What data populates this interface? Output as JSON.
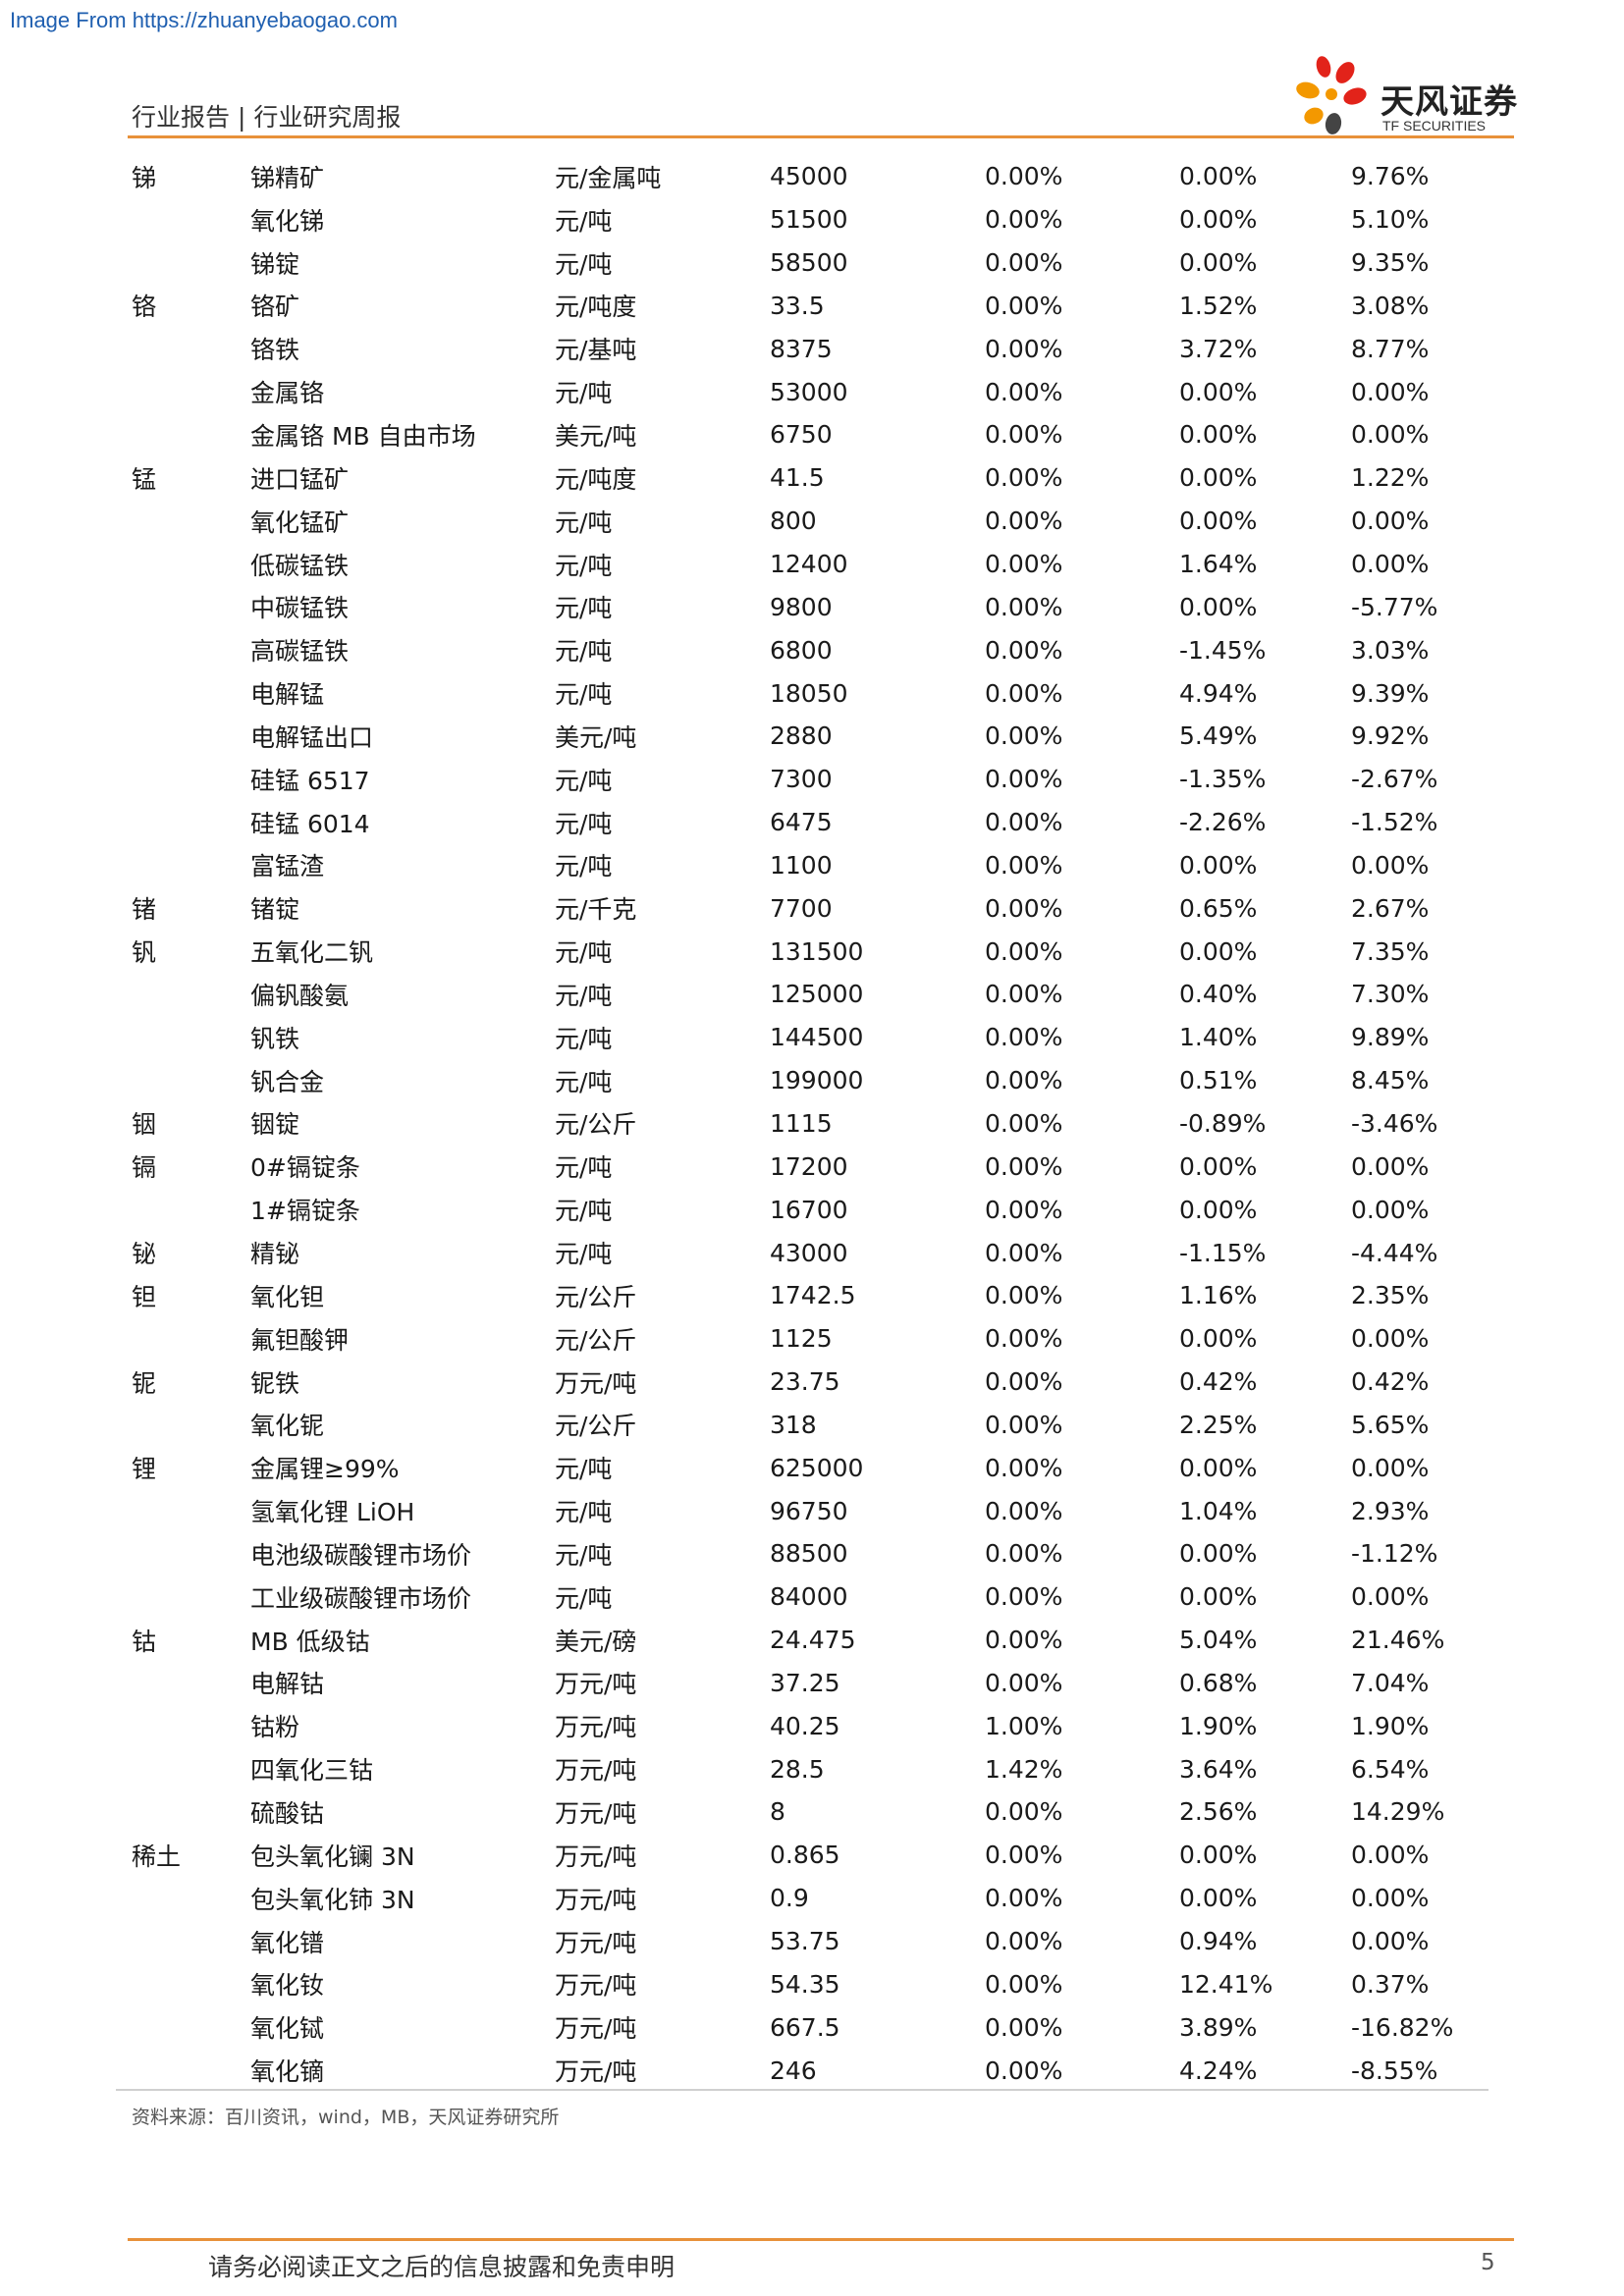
{
  "source_url": "Image From https://zhuanyebaogao.com",
  "header": {
    "title": "行业报告 | 行业研究周报",
    "logo_name": "天风证券",
    "logo_sub": "TF SECURITIES"
  },
  "table": {
    "rows": [
      {
        "metal": "锑",
        "product": "锑精矿",
        "unit": "元/金属吨",
        "price": "45000",
        "weekly": "0.00%",
        "monthly": "0.00%",
        "yearly": "9.76%"
      },
      {
        "metal": "",
        "product": "氧化锑",
        "unit": "元/吨",
        "price": "51500",
        "weekly": "0.00%",
        "monthly": "0.00%",
        "yearly": "5.10%"
      },
      {
        "metal": "",
        "product": "锑锭",
        "unit": "元/吨",
        "price": "58500",
        "weekly": "0.00%",
        "monthly": "0.00%",
        "yearly": "9.35%"
      },
      {
        "metal": "铬",
        "product": "铬矿",
        "unit": "元/吨度",
        "price": "33.5",
        "weekly": "0.00%",
        "monthly": "1.52%",
        "yearly": "3.08%"
      },
      {
        "metal": "",
        "product": "铬铁",
        "unit": "元/基吨",
        "price": "8375",
        "weekly": "0.00%",
        "monthly": "3.72%",
        "yearly": "8.77%"
      },
      {
        "metal": "",
        "product": "金属铬",
        "unit": "元/吨",
        "price": "53000",
        "weekly": "0.00%",
        "monthly": "0.00%",
        "yearly": "0.00%"
      },
      {
        "metal": "",
        "product": "金属铬 MB 自由市场",
        "unit": "美元/吨",
        "price": "6750",
        "weekly": "0.00%",
        "monthly": "0.00%",
        "yearly": "0.00%"
      },
      {
        "metal": "锰",
        "product": "进口锰矿",
        "unit": "元/吨度",
        "price": "41.5",
        "weekly": "0.00%",
        "monthly": "0.00%",
        "yearly": "1.22%"
      },
      {
        "metal": "",
        "product": "氧化锰矿",
        "unit": "元/吨",
        "price": "800",
        "weekly": "0.00%",
        "monthly": "0.00%",
        "yearly": "0.00%"
      },
      {
        "metal": "",
        "product": "低碳锰铁",
        "unit": "元/吨",
        "price": "12400",
        "weekly": "0.00%",
        "monthly": "1.64%",
        "yearly": "0.00%"
      },
      {
        "metal": "",
        "product": "中碳锰铁",
        "unit": "元/吨",
        "price": "9800",
        "weekly": "0.00%",
        "monthly": "0.00%",
        "yearly": "-5.77%"
      },
      {
        "metal": "",
        "product": "高碳锰铁",
        "unit": "元/吨",
        "price": "6800",
        "weekly": "0.00%",
        "monthly": "-1.45%",
        "yearly": "3.03%"
      },
      {
        "metal": "",
        "product": "电解锰",
        "unit": "元/吨",
        "price": "18050",
        "weekly": "0.00%",
        "monthly": "4.94%",
        "yearly": "9.39%"
      },
      {
        "metal": "",
        "product": "电解锰出口",
        "unit": "美元/吨",
        "price": "2880",
        "weekly": "0.00%",
        "monthly": "5.49%",
        "yearly": "9.92%"
      },
      {
        "metal": "",
        "product": "硅锰 6517",
        "unit": "元/吨",
        "price": "7300",
        "weekly": "0.00%",
        "monthly": "-1.35%",
        "yearly": "-2.67%"
      },
      {
        "metal": "",
        "product": "硅锰 6014",
        "unit": "元/吨",
        "price": "6475",
        "weekly": "0.00%",
        "monthly": "-2.26%",
        "yearly": "-1.52%"
      },
      {
        "metal": "",
        "product": "富锰渣",
        "unit": "元/吨",
        "price": "1100",
        "weekly": "0.00%",
        "monthly": "0.00%",
        "yearly": "0.00%"
      },
      {
        "metal": "锗",
        "product": "锗锭",
        "unit": "元/千克",
        "price": "7700",
        "weekly": "0.00%",
        "monthly": "0.65%",
        "yearly": "2.67%"
      },
      {
        "metal": "钒",
        "product": "五氧化二钒",
        "unit": "元/吨",
        "price": "131500",
        "weekly": "0.00%",
        "monthly": "0.00%",
        "yearly": "7.35%"
      },
      {
        "metal": "",
        "product": "偏钒酸氨",
        "unit": "元/吨",
        "price": "125000",
        "weekly": "0.00%",
        "monthly": "0.40%",
        "yearly": "7.30%"
      },
      {
        "metal": "",
        "product": "钒铁",
        "unit": "元/吨",
        "price": "144500",
        "weekly": "0.00%",
        "monthly": "1.40%",
        "yearly": "9.89%"
      },
      {
        "metal": "",
        "product": "钒合金",
        "unit": "元/吨",
        "price": "199000",
        "weekly": "0.00%",
        "monthly": "0.51%",
        "yearly": "8.45%"
      },
      {
        "metal": "铟",
        "product": "铟锭",
        "unit": "元/公斤",
        "price": "1115",
        "weekly": "0.00%",
        "monthly": "-0.89%",
        "yearly": "-3.46%"
      },
      {
        "metal": "镉",
        "product": "0#镉锭条",
        "unit": "元/吨",
        "price": "17200",
        "weekly": "0.00%",
        "monthly": "0.00%",
        "yearly": "0.00%"
      },
      {
        "metal": "",
        "product": "1#镉锭条",
        "unit": "元/吨",
        "price": "16700",
        "weekly": "0.00%",
        "monthly": "0.00%",
        "yearly": "0.00%"
      },
      {
        "metal": "铋",
        "product": "精铋",
        "unit": "元/吨",
        "price": "43000",
        "weekly": "0.00%",
        "monthly": "-1.15%",
        "yearly": "-4.44%"
      },
      {
        "metal": "钽",
        "product": "氧化钽",
        "unit": "元/公斤",
        "price": "1742.5",
        "weekly": "0.00%",
        "monthly": "1.16%",
        "yearly": "2.35%"
      },
      {
        "metal": "",
        "product": "氟钽酸钾",
        "unit": "元/公斤",
        "price": "1125",
        "weekly": "0.00%",
        "monthly": "0.00%",
        "yearly": "0.00%"
      },
      {
        "metal": "铌",
        "product": "铌铁",
        "unit": "万元/吨",
        "price": "23.75",
        "weekly": "0.00%",
        "monthly": "0.42%",
        "yearly": "0.42%"
      },
      {
        "metal": "",
        "product": "氧化铌",
        "unit": "元/公斤",
        "price": "318",
        "weekly": "0.00%",
        "monthly": "2.25%",
        "yearly": "5.65%"
      },
      {
        "metal": "锂",
        "product": "金属锂≥99%",
        "unit": "元/吨",
        "price": "625000",
        "weekly": "0.00%",
        "monthly": "0.00%",
        "yearly": "0.00%"
      },
      {
        "metal": "",
        "product": "氢氧化锂 LiOH",
        "unit": "元/吨",
        "price": "96750",
        "weekly": "0.00%",
        "monthly": "1.04%",
        "yearly": "2.93%"
      },
      {
        "metal": "",
        "product": "电池级碳酸锂市场价",
        "unit": "元/吨",
        "price": "88500",
        "weekly": "0.00%",
        "monthly": "0.00%",
        "yearly": "-1.12%"
      },
      {
        "metal": "",
        "product": "工业级碳酸锂市场价",
        "unit": "元/吨",
        "price": "84000",
        "weekly": "0.00%",
        "monthly": "0.00%",
        "yearly": "0.00%"
      },
      {
        "metal": "钴",
        "product": "MB 低级钴",
        "unit": "美元/磅",
        "price": "24.475",
        "weekly": "0.00%",
        "monthly": "5.04%",
        "yearly": "21.46%"
      },
      {
        "metal": "",
        "product": "电解钴",
        "unit": "万元/吨",
        "price": "37.25",
        "weekly": "0.00%",
        "monthly": "0.68%",
        "yearly": "7.04%"
      },
      {
        "metal": "",
        "product": "钴粉",
        "unit": "万元/吨",
        "price": "40.25",
        "weekly": "1.00%",
        "monthly": "1.90%",
        "yearly": "1.90%"
      },
      {
        "metal": "",
        "product": "四氧化三钴",
        "unit": "万元/吨",
        "price": "28.5",
        "weekly": "1.42%",
        "monthly": "3.64%",
        "yearly": "6.54%"
      },
      {
        "metal": "",
        "product": "硫酸钴",
        "unit": "万元/吨",
        "price": "8",
        "weekly": "0.00%",
        "monthly": "2.56%",
        "yearly": "14.29%"
      },
      {
        "metal": "稀土",
        "product": "包头氧化镧 3N",
        "unit": "万元/吨",
        "price": "0.865",
        "weekly": "0.00%",
        "monthly": "0.00%",
        "yearly": "0.00%"
      },
      {
        "metal": "",
        "product": "包头氧化铈 3N",
        "unit": "万元/吨",
        "price": "0.9",
        "weekly": "0.00%",
        "monthly": "0.00%",
        "yearly": "0.00%"
      },
      {
        "metal": "",
        "product": "氧化镨",
        "unit": "万元/吨",
        "price": "53.75",
        "weekly": "0.00%",
        "monthly": "0.94%",
        "yearly": "0.00%"
      },
      {
        "metal": "",
        "product": "氧化钕",
        "unit": "万元/吨",
        "price": "54.35",
        "weekly": "0.00%",
        "monthly": "12.41%",
        "yearly": "0.37%"
      },
      {
        "metal": "",
        "product": "氧化铽",
        "unit": "万元/吨",
        "price": "667.5",
        "weekly": "0.00%",
        "monthly": "3.89%",
        "yearly": "-16.82%"
      },
      {
        "metal": "",
        "product": "氧化镝",
        "unit": "万元/吨",
        "price": "246",
        "weekly": "0.00%",
        "monthly": "4.24%",
        "yearly": "-8.55%"
      }
    ]
  },
  "source_note": "资料来源：百川资讯，wind，MB，天风证券研究所",
  "footer": {
    "disclaimer": "请务必阅读正文之后的信息披露和免责申明",
    "page_number": "5"
  },
  "colors": {
    "accent_rule": "#e8913a",
    "url_link": "#1f5fb0",
    "logo_red": "#e2231a",
    "logo_orange": "#f39800",
    "logo_dark": "#222222"
  }
}
